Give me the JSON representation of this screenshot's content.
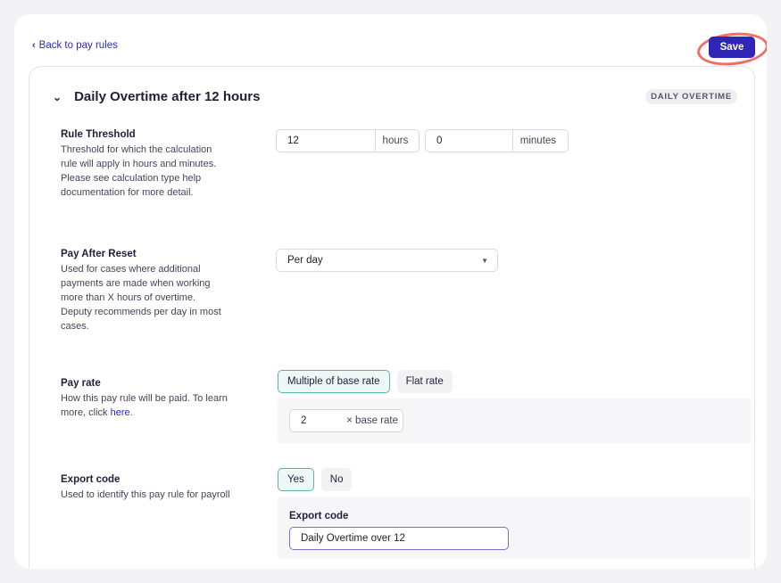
{
  "nav": {
    "back_label": "Back to pay rules",
    "back_icon": "chevron-left-icon"
  },
  "toolbar": {
    "save_label": "Save",
    "save_color": "#3125b8",
    "highlight_color": "#ef6e6b"
  },
  "rule": {
    "title": "Daily Overtime after 12 hours",
    "type_badge": "DAILY OVERTIME",
    "threshold": {
      "label": "Rule Threshold",
      "description": "Threshold for which the calculation rule will apply in hours and minutes. Please see calculation type help documentation for more detail.",
      "hours_value": "12",
      "hours_unit": "hours",
      "minutes_value": "0",
      "minutes_unit": "minutes"
    },
    "pay_after_reset": {
      "label": "Pay After Reset",
      "description": "Used for cases where additional payments are made when working more than X hours of overtime. Deputy recommends per day in most cases.",
      "selected": "Per day"
    },
    "pay_rate": {
      "label": "Pay rate",
      "description_prefix": "How this pay rule will be paid. To learn more, click ",
      "link_text": "here",
      "description_suffix": ".",
      "options": [
        "Multiple of base rate",
        "Flat rate"
      ],
      "selected": "Multiple of base rate",
      "multiplier_value": "2",
      "multiplier_suffix": "× base rate"
    },
    "export": {
      "label": "Export code",
      "description": "Used to identify this pay rule for payroll",
      "options": [
        "Yes",
        "No"
      ],
      "selected": "Yes",
      "field_label": "Export code",
      "field_value": "Daily Overtime over 12"
    }
  }
}
